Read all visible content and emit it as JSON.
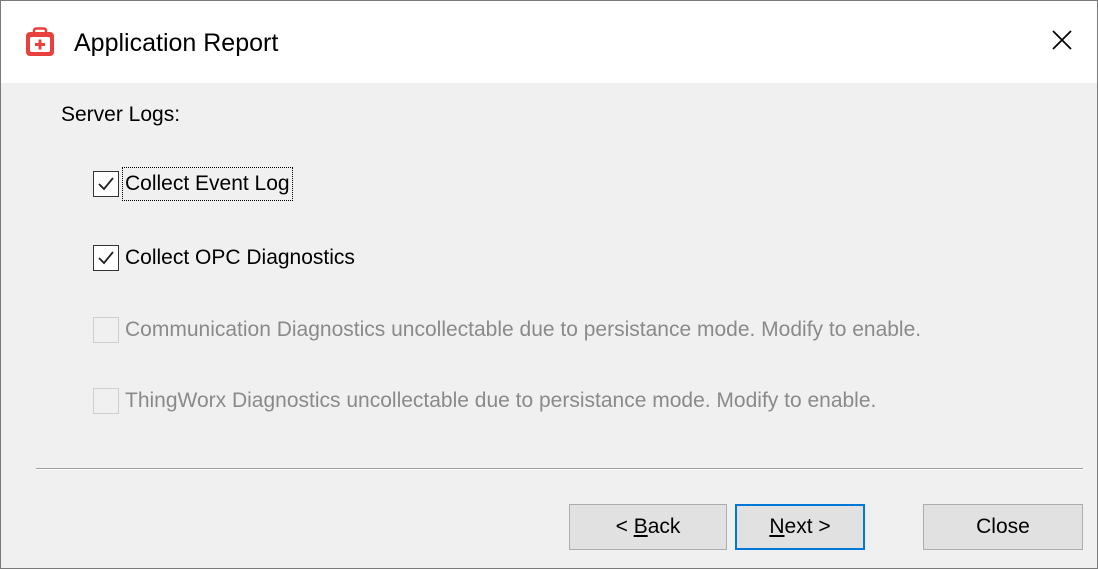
{
  "window": {
    "title": "Application Report",
    "icon": "red-toolbox-icon",
    "close_icon": "close-icon"
  },
  "section_label": "Server Logs:",
  "checkboxes": [
    {
      "label": "Collect Event Log",
      "checked": true,
      "enabled": true,
      "focused": true
    },
    {
      "label": "Collect OPC Diagnostics",
      "checked": true,
      "enabled": true,
      "focused": false
    },
    {
      "label": "Communication Diagnostics uncollectable due to persistance mode. Modify to enable.",
      "checked": false,
      "enabled": false
    },
    {
      "label": "ThingWorx Diagnostics uncollectable due to persistance mode. Modify to enable.",
      "checked": false,
      "enabled": false
    }
  ],
  "buttons": {
    "back": {
      "prefix": "< ",
      "mnemonic": "B",
      "rest": "ack"
    },
    "next": {
      "mnemonic": "N",
      "rest": "ext >"
    },
    "close": {
      "label": "Close"
    }
  },
  "colors": {
    "accent": "#0078d7",
    "icon_red": "#e8413d",
    "disabled_text": "#8a8a8a"
  }
}
